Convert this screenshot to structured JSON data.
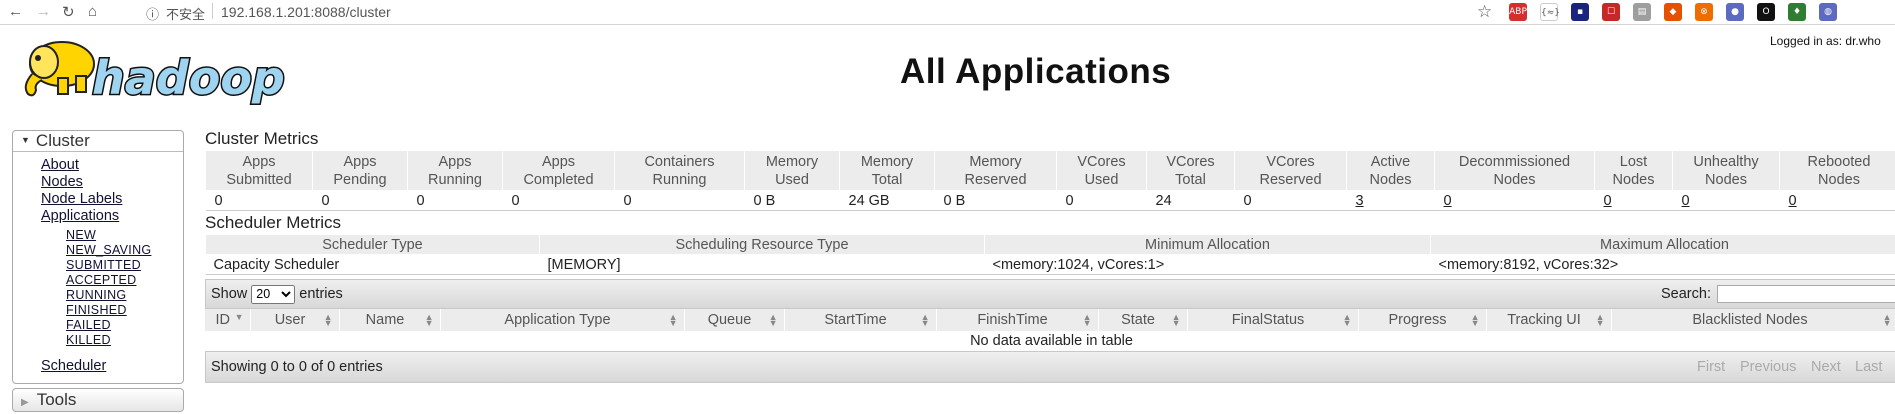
{
  "browser": {
    "security_label": "不安全",
    "url": "192.168.1.201:8088/cluster",
    "extensions": [
      {
        "name": "abp-icon",
        "label": "ABP",
        "color": "#d32f2f"
      },
      {
        "name": "json-icon",
        "label": "{≈}",
        "color": "#ffffff"
      },
      {
        "name": "ext-dark-icon",
        "label": "▪",
        "color": "#1a237e"
      },
      {
        "name": "ext-red-icon",
        "label": "☐",
        "color": "#c62828"
      },
      {
        "name": "ext-doc-icon",
        "label": "▤",
        "color": "#9e9e9e"
      },
      {
        "name": "gitlab-icon",
        "label": "◆",
        "color": "#e65100"
      },
      {
        "name": "ext-orange-icon",
        "label": "⊗",
        "color": "#ef6c00"
      },
      {
        "name": "ext-globe-icon",
        "label": "●",
        "color": "#5c6bc0"
      },
      {
        "name": "ext-ring-icon",
        "label": "O",
        "color": "#111111"
      },
      {
        "name": "ext-green-icon",
        "label": "♦",
        "color": "#2e7d32"
      },
      {
        "name": "ext-earth-icon",
        "label": "◍",
        "color": "#5c6bc0"
      }
    ]
  },
  "header": {
    "logo_text": "hadoop",
    "title": "All Applications",
    "logged_in": "Logged in as: dr.who"
  },
  "sidebar": {
    "cluster_label": "Cluster",
    "links": [
      "About",
      "Nodes",
      "Node Labels",
      "Applications"
    ],
    "app_states": [
      "NEW",
      "NEW_SAVING",
      "SUBMITTED",
      "ACCEPTED",
      "RUNNING",
      "FINISHED",
      "FAILED",
      "KILLED"
    ],
    "scheduler_label": "Scheduler",
    "tools_label": "Tools"
  },
  "cluster_metrics": {
    "title": "Cluster Metrics",
    "columns": [
      {
        "line1": "Apps",
        "line2": "Submitted",
        "value": "0",
        "link": false
      },
      {
        "line1": "Apps",
        "line2": "Pending",
        "value": "0",
        "link": false
      },
      {
        "line1": "Apps",
        "line2": "Running",
        "value": "0",
        "link": false
      },
      {
        "line1": "Apps",
        "line2": "Completed",
        "value": "0",
        "link": false
      },
      {
        "line1": "Containers",
        "line2": "Running",
        "value": "0",
        "link": false
      },
      {
        "line1": "Memory",
        "line2": "Used",
        "value": "0 B",
        "link": false
      },
      {
        "line1": "Memory",
        "line2": "Total",
        "value": "24 GB",
        "link": false
      },
      {
        "line1": "Memory",
        "line2": "Reserved",
        "value": "0 B",
        "link": false
      },
      {
        "line1": "VCores",
        "line2": "Used",
        "value": "0",
        "link": false
      },
      {
        "line1": "VCores",
        "line2": "Total",
        "value": "24",
        "link": false
      },
      {
        "line1": "VCores",
        "line2": "Reserved",
        "value": "0",
        "link": false
      },
      {
        "line1": "Active",
        "line2": "Nodes",
        "value": "3",
        "link": true
      },
      {
        "line1": "Decommissioned",
        "line2": "Nodes",
        "value": "0",
        "link": true
      },
      {
        "line1": "Lost",
        "line2": "Nodes",
        "value": "0",
        "link": true
      },
      {
        "line1": "Unhealthy",
        "line2": "Nodes",
        "value": "0",
        "link": true
      },
      {
        "line1": "Rebooted",
        "line2": "Nodes",
        "value": "0",
        "link": true
      }
    ]
  },
  "scheduler_metrics": {
    "title": "Scheduler Metrics",
    "headers": [
      "Scheduler Type",
      "Scheduling Resource Type",
      "Minimum Allocation",
      "Maximum Allocation"
    ],
    "row": [
      "Capacity Scheduler",
      "[MEMORY]",
      "<memory:1024, vCores:1>",
      "<memory:8192, vCores:32>"
    ]
  },
  "apps_table": {
    "show_label": "Show",
    "page_size": "20",
    "entries_label": "entries",
    "search_label": "Search:",
    "headers": [
      "ID",
      "User",
      "Name",
      "Application Type",
      "Queue",
      "StartTime",
      "FinishTime",
      "State",
      "FinalStatus",
      "Progress",
      "Tracking UI",
      "Blacklisted Nodes"
    ],
    "empty_message": "No data available in table",
    "info": "Showing 0 to 0 of 0 entries",
    "pager": [
      "First",
      "Previous",
      "Next",
      "Last"
    ]
  }
}
